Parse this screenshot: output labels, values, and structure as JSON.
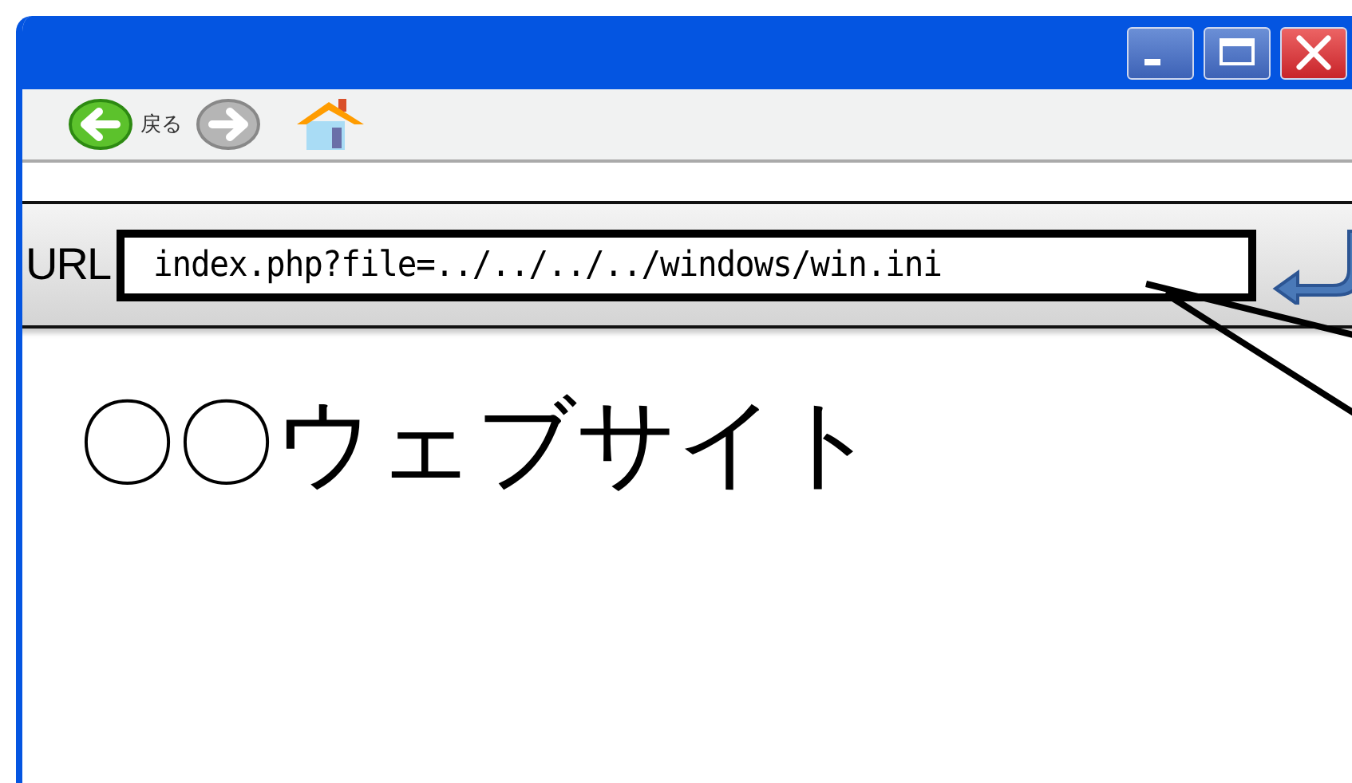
{
  "toolbar": {
    "back_label": "戻る"
  },
  "address_bar": {
    "label": "URL",
    "value": "index.php?file=../../../../windows/win.ini"
  },
  "page": {
    "heading": "〇〇ウェブサイト"
  }
}
